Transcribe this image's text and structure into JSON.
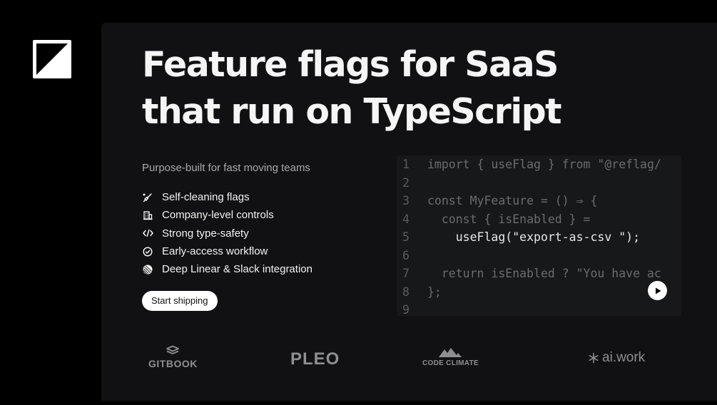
{
  "brand": {
    "logo_icon": "reflag-logo-icon"
  },
  "hero": {
    "headline_line1": "Feature flags for SaaS",
    "headline_line2": "that run on TypeScript",
    "subtitle": "Purpose-built for fast moving teams"
  },
  "features": [
    {
      "label": "Self-cleaning flags",
      "icon": "broom-icon"
    },
    {
      "label": "Company-level controls",
      "icon": "building-icon"
    },
    {
      "label": "Strong type-safety",
      "icon": "code-icon"
    },
    {
      "label": "Early-access workflow",
      "icon": "check-circle-icon"
    },
    {
      "label": "Deep Linear & Slack integration",
      "icon": "linear-icon"
    }
  ],
  "cta": {
    "label": "Start shipping"
  },
  "code": {
    "lines": [
      {
        "n": "1",
        "text": "import { useFlag } from \"@reflag/",
        "highlight": false
      },
      {
        "n": "2",
        "text": "",
        "highlight": false
      },
      {
        "n": "3",
        "text": "const MyFeature = () ⇒ {",
        "highlight": false
      },
      {
        "n": "4",
        "text": "  const { isEnabled } =",
        "highlight": false
      },
      {
        "n": "5",
        "text": "    useFlag(\"export-as-csv \");",
        "highlight": true
      },
      {
        "n": "6",
        "text": "",
        "highlight": false
      },
      {
        "n": "7",
        "text": "  return isEnabled ? \"You have ac",
        "highlight": false
      },
      {
        "n": "8",
        "text": "};",
        "highlight": false
      },
      {
        "n": "9",
        "text": "",
        "highlight": false
      }
    ],
    "play_icon": "play-icon"
  },
  "customers": {
    "gitbook": "GITBOOK",
    "pleo": "PLEO",
    "code_climate": "CODE CLIMATE",
    "aiwork": "ai.work"
  },
  "colors": {
    "background": "#000000",
    "panel": "#111113",
    "code_bg": "#17181a",
    "text_muted": "#a9a9ad",
    "logo_gray": "#8e8f93"
  }
}
